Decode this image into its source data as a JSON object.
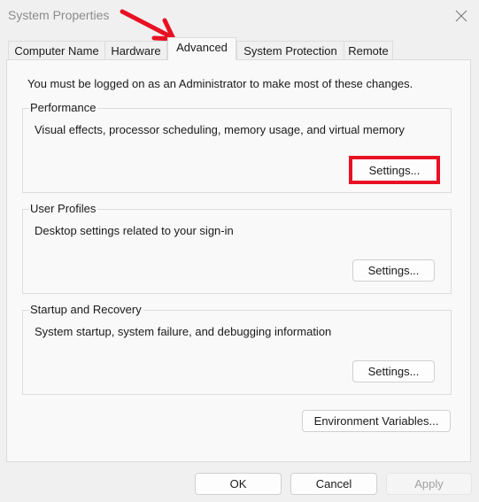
{
  "window": {
    "title": "System Properties",
    "close_icon": "close-icon"
  },
  "annotation": {
    "arrow_color": "#e81123",
    "highlight_color": "#e81123",
    "arrow_target": "Advanced"
  },
  "tabs": [
    {
      "label": "Computer Name",
      "active": false
    },
    {
      "label": "Hardware",
      "active": false
    },
    {
      "label": "Advanced",
      "active": true
    },
    {
      "label": "System Protection",
      "active": false
    },
    {
      "label": "Remote",
      "active": false
    }
  ],
  "advanced": {
    "notice": "You must be logged on as an Administrator to make most of these changes.",
    "groups": [
      {
        "label": "Performance",
        "description": "Visual effects, processor scheduling, memory usage, and virtual memory",
        "button": "Settings...",
        "highlighted": true
      },
      {
        "label": "User Profiles",
        "description": "Desktop settings related to your sign-in",
        "button": "Settings...",
        "highlighted": false
      },
      {
        "label": "Startup and Recovery",
        "description": "System startup, system failure, and debugging information",
        "button": "Settings...",
        "highlighted": false
      }
    ],
    "env_button": "Environment Variables..."
  },
  "footer": {
    "ok": "OK",
    "cancel": "Cancel",
    "apply": "Apply",
    "apply_enabled": false
  }
}
